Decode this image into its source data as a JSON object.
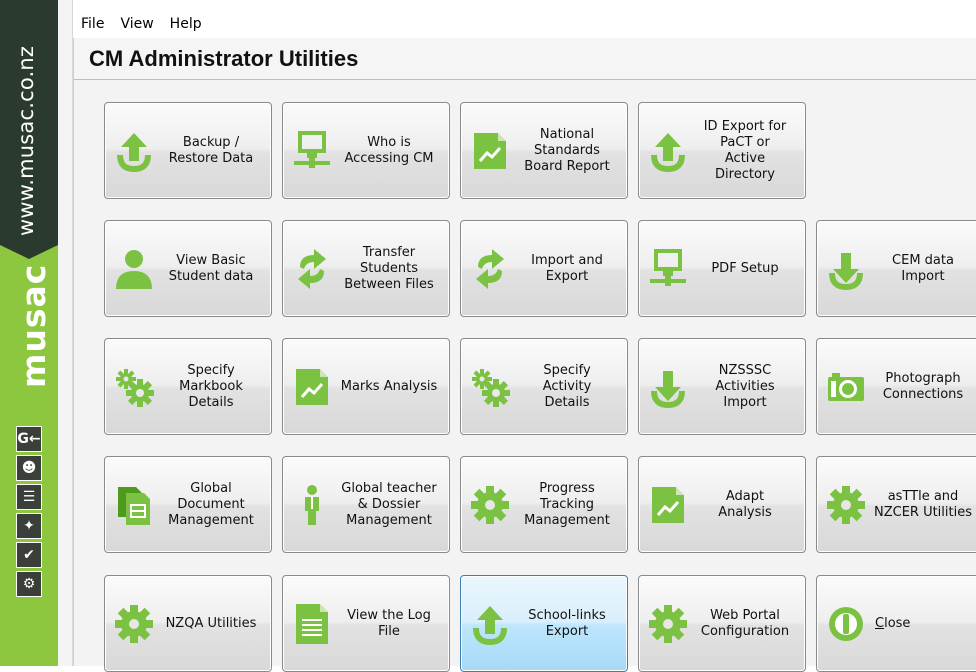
{
  "sidebar": {
    "url": "www.musac.co.nz",
    "logo": "musac",
    "icons": [
      "exit-icon",
      "user-icon",
      "report-icon",
      "puzzle-icon",
      "check-icon",
      "gear-icon"
    ],
    "glyphs": [
      "G←",
      "☻",
      "☰",
      "✦",
      "✔",
      "⚙"
    ]
  },
  "menu": [
    "File",
    "View",
    "Help"
  ],
  "window": {
    "title": "CM Administrator Utilities"
  },
  "colors": {
    "green": "#8dc63f",
    "dark": "#2b3a2f",
    "accent_blue": "#3c7fb1"
  },
  "tiles": [
    {
      "label": "Backup  /\nRestore Data",
      "icon": "upload-icon"
    },
    {
      "label": "Who is\nAccessing CM",
      "icon": "network-computer-icon"
    },
    {
      "label": "National\nStandards\nBoard Report",
      "icon": "chart-document-icon"
    },
    {
      "label": "ID Export for\nPaCT or\nActive\nDirectory",
      "icon": "upload-icon"
    },
    {
      "label": "View Basic\nStudent data",
      "icon": "person-icon"
    },
    {
      "label": "Transfer\nStudents\nBetween Files",
      "icon": "refresh-arrows-icon"
    },
    {
      "label": "Import and\nExport",
      "icon": "refresh-arrows-icon"
    },
    {
      "label": "PDF Setup",
      "icon": "network-computer-icon"
    },
    {
      "label": "CEM data\nImport",
      "icon": "download-icon"
    },
    {
      "label": "Specify\nMarkbook\nDetails",
      "icon": "gears-icon"
    },
    {
      "label": "Marks Analysis",
      "icon": "chart-document-icon"
    },
    {
      "label": "Specify\nActivity\nDetails",
      "icon": "gears-icon"
    },
    {
      "label": "NZSSSC\nActivities\nImport",
      "icon": "download-icon"
    },
    {
      "label": "Photograph\nConnections",
      "icon": "camera-icon"
    },
    {
      "label": "Global\nDocument\nManagement",
      "icon": "documents-icon"
    },
    {
      "label": "Global teacher\n& Dossier\nManagement",
      "icon": "teacher-icon"
    },
    {
      "label": "Progress\nTracking\nManagement",
      "icon": "gear-icon"
    },
    {
      "label": "Adapt\nAnalysis",
      "icon": "chart-document-icon"
    },
    {
      "label": "asTTle and\nNZCER Utilities",
      "icon": "gear-icon"
    },
    {
      "label": "NZQA Utilities",
      "icon": "gear-icon"
    },
    {
      "label": "View  the Log\nFile",
      "icon": "text-document-icon"
    },
    {
      "label": "School-links\nExport",
      "icon": "upload-icon",
      "active": true
    },
    {
      "label": "Web Portal\nConfiguration",
      "icon": "gear-icon"
    },
    {
      "label": "Close",
      "icon": "power-icon"
    }
  ]
}
